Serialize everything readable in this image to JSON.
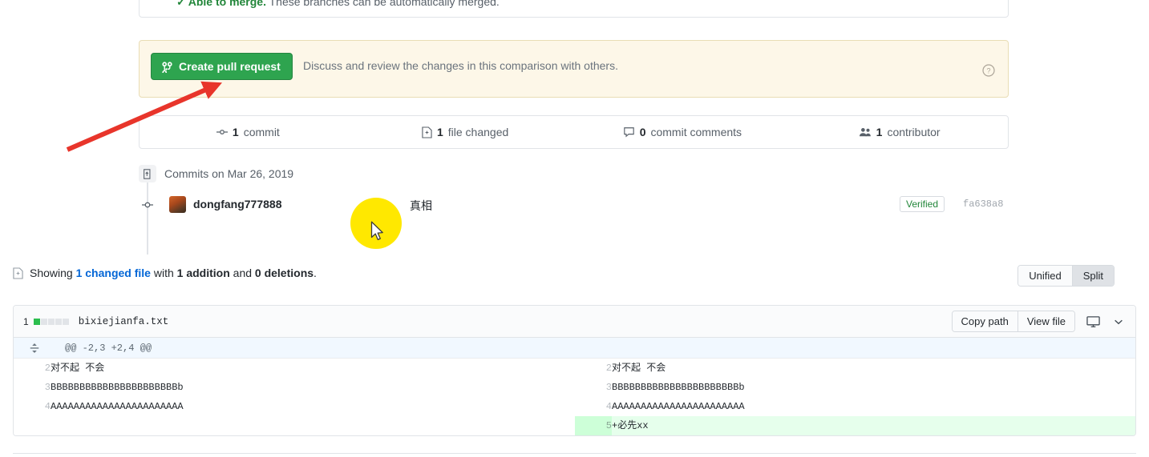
{
  "merge_banner": {
    "check_icon": "check-icon",
    "status_label": "Able to merge.",
    "description": "These branches can be automatically merged."
  },
  "pr_panel": {
    "create_button_label": "Create pull request",
    "create_button_icon": "git-pull-request-icon",
    "description": "Discuss and review the changes in this comparison with others.",
    "help_icon": "question-circle-icon",
    "background_color": "#fdf7e8",
    "button_color": "#2ea44f"
  },
  "stats": [
    {
      "icon": "commit-icon",
      "count": "1",
      "label": "commit"
    },
    {
      "icon": "file-icon",
      "count": "1",
      "label": "file changed"
    },
    {
      "icon": "comment-icon",
      "count": "0",
      "label": "commit comments"
    },
    {
      "icon": "people-icon",
      "count": "1",
      "label": "contributor"
    }
  ],
  "commits": {
    "date_icon": "commits-icon",
    "date_label": "Commits on Mar 26, 2019",
    "commit": {
      "dot_icon": "commit-dot-icon",
      "avatar": "avatar",
      "author": "dongfang777888",
      "message": "真相",
      "verified_label": "Verified",
      "sha": "fa638a8"
    }
  },
  "showing": {
    "icon": "file-diff-icon",
    "prefix": "Showing ",
    "changed_file": "1 changed file",
    "middle": " with ",
    "additions": "1 addition",
    "conjunction": " and ",
    "deletions": "0 deletions",
    "suffix": "."
  },
  "diff_toggle": {
    "unified_label": "Unified",
    "split_label": "Split",
    "selected": "Split"
  },
  "diff_file": {
    "diffstat_count": "1",
    "diffstat_blocks": [
      "add",
      "empty",
      "empty",
      "empty",
      "empty"
    ],
    "filename": "bixiejianfa.txt",
    "copy_path_label": "Copy path",
    "view_file_label": "View file",
    "view_mode_icon": "display-icon",
    "view_options_icon": "chevron-down-icon",
    "hunk_expand_icon": "unfold-icon",
    "hunk_header": "@@ -2,3 +2,4 @@",
    "rows": [
      {
        "type": "context",
        "left_num": "2",
        "left_code": "对不起 不会",
        "right_num": "2",
        "right_code": "对不起 不会"
      },
      {
        "type": "context",
        "left_num": "3",
        "left_code": "BBBBBBBBBBBBBBBBBBBBBBb",
        "right_num": "3",
        "right_code": "BBBBBBBBBBBBBBBBBBBBBBb"
      },
      {
        "type": "context",
        "left_num": "4",
        "left_code": "AAAAAAAAAAAAAAAAAAAAAAA",
        "right_num": "4",
        "right_code": "AAAAAAAAAAAAAAAAAAAAAAA"
      },
      {
        "type": "added",
        "left_num": "",
        "left_code": "",
        "right_num": "5",
        "right_code": "+必先xx"
      }
    ]
  },
  "annotations": {
    "arrow_color": "#e8352b",
    "click_highlight_color": "#ffe800",
    "cursor_icon": "mouse-pointer-icon"
  }
}
